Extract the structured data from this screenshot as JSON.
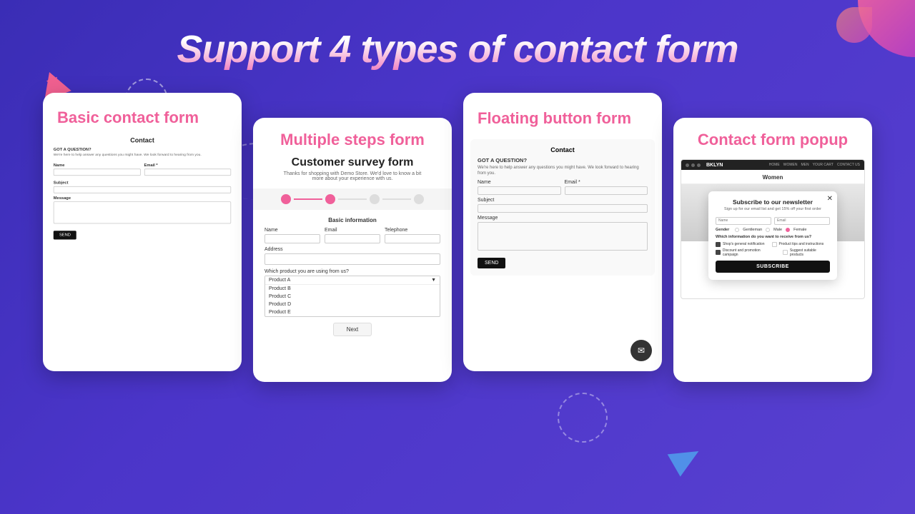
{
  "page": {
    "title": "Support 4 types of contact form"
  },
  "cards": [
    {
      "id": "basic",
      "title": "Basic contact form",
      "form": {
        "heading": "Contact",
        "section_title": "GOT A QUESTION?",
        "desc": "We're here to help answer any questions you might have. We look forward to hearing from you.",
        "name_label": "Name",
        "email_label": "Email *",
        "subject_label": "Subject",
        "message_label": "Message",
        "send_btn": "SEND"
      }
    },
    {
      "id": "multiple-steps",
      "title": "Multiple steps form",
      "form": {
        "survey_title": "Customer survey form",
        "survey_desc": "Thanks for shopping with Demo Store. We'd love to know a bit more about your experience with us.",
        "section_label": "Basic information",
        "name_label": "Name",
        "email_label": "Email",
        "telephone_label": "Telephone",
        "address_label": "Address",
        "product_label": "Which product you are using from us?",
        "product_placeholder": "Product A",
        "products": [
          "Product A",
          "Product B",
          "Product C",
          "Product D",
          "Product E"
        ],
        "next_btn": "Next"
      }
    },
    {
      "id": "floating-button",
      "title": "Floating button form",
      "form": {
        "heading": "Contact",
        "section_title": "GOT A QUESTION?",
        "desc": "We're here to help answer any questions you might have. We look forward to hearing from you.",
        "name_label": "Name",
        "email_label": "Email *",
        "subject_label": "Subject",
        "message_label": "Message",
        "send_btn": "SEND",
        "fab_icon": "✉"
      }
    },
    {
      "id": "popup",
      "title": "Contact form popup",
      "browser": {
        "store_name": "BKLYN",
        "page_title": "Women",
        "nav_links": [
          "HOME",
          "WOMEN",
          "MEN",
          "YOUR CART",
          "CONTACT US"
        ]
      },
      "popup": {
        "title": "Subscribe to our newsletter",
        "desc": "Sign up for our email list and get 15% off your first order",
        "name_placeholder": "Name",
        "email_placeholder": "Email",
        "gender_label": "Gender",
        "gender_options": [
          "Gentleman",
          "Male",
          "Female"
        ],
        "gender_selected": "Female",
        "info_label": "Which information do you want to receive from us?",
        "checkboxes": [
          {
            "label": "Shop's general notification",
            "checked": true
          },
          {
            "label": "Product tips and instructions",
            "checked": false
          },
          {
            "label": "Discount and promotion campaign",
            "checked": true
          },
          {
            "label": "Suggest suitable products",
            "checked": false
          }
        ],
        "subscribe_btn": "SUBSCRIBE",
        "close_icon": "✕"
      }
    }
  ]
}
